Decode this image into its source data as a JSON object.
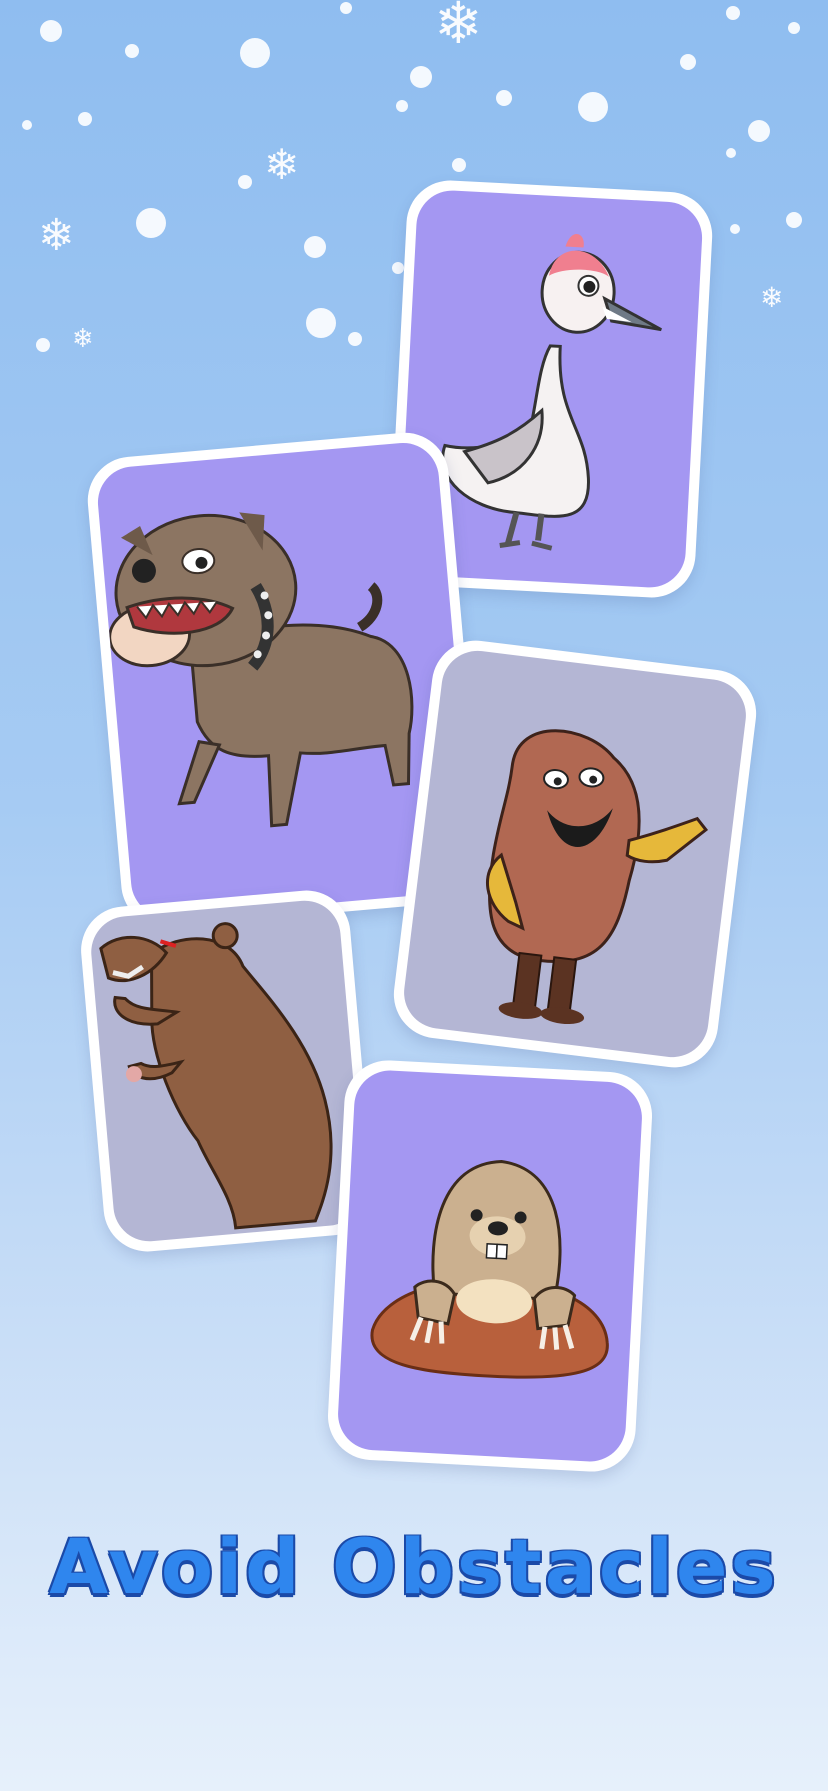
{
  "screen": {
    "title": "Avoid Obstacles"
  },
  "cards": [
    {
      "subject": "crane-bird",
      "color": "purple"
    },
    {
      "subject": "bulldog",
      "color": "purple"
    },
    {
      "subject": "potato-creature",
      "color": "grey"
    },
    {
      "subject": "bear",
      "color": "grey"
    },
    {
      "subject": "mole",
      "color": "purple"
    }
  ],
  "colors": {
    "background_top": "#8fbdf0",
    "background_bottom": "#e6f0fb",
    "card_purple": "#a497f2",
    "card_grey": "#b4b6d4",
    "title": "#2f86ee",
    "title_outline": "#1b4aa8"
  },
  "decorations": {
    "snowflake_icon": "❄"
  }
}
